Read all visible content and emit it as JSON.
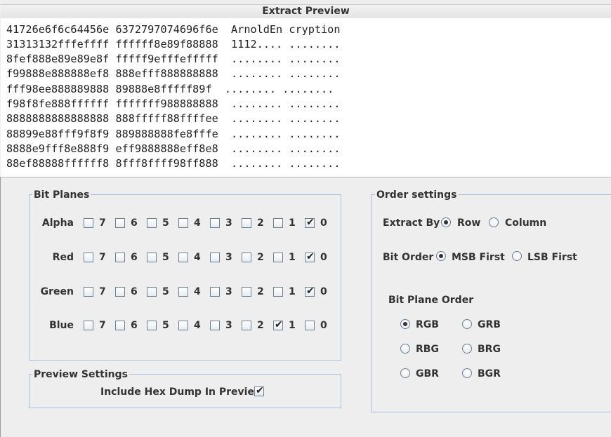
{
  "preview": {
    "title": "Extract Preview",
    "lines": [
      "41726e6f6c64456e 6372797074696f6e  ArnoldEn cryption",
      "31313132fffeffff ffffff8e89f88888  1112.... ........",
      "8fef888e89e89e8f fffff9efffefffff  ........ ........",
      "f99888e888888ef8 888efff888888888  ........ ........",
      "fff98ee888889888 89888e8fffff89f  ........ ........",
      "f98f8fe888ffffff fffffff988888888  ........ ........",
      "8888888888888888 888fffff88ffffee  ........ ........",
      "88899e88fff9f8f9 889888888fe8fffe  ........ ........",
      "8888e9fff8e888f9 eff9888888eff8e8  ........ ........",
      "88ef88888ffffff8 8fff8ffff98ff888  ........ ........"
    ]
  },
  "bit_planes": {
    "title": "Bit Planes",
    "bits": [
      "7",
      "6",
      "5",
      "4",
      "3",
      "2",
      "1",
      "0"
    ],
    "rows": [
      {
        "label": "Alpha",
        "checked": [
          false,
          false,
          false,
          false,
          false,
          false,
          false,
          true
        ]
      },
      {
        "label": "Red",
        "checked": [
          false,
          false,
          false,
          false,
          false,
          false,
          false,
          true
        ]
      },
      {
        "label": "Green",
        "checked": [
          false,
          false,
          false,
          false,
          false,
          false,
          false,
          true
        ]
      },
      {
        "label": "Blue",
        "checked": [
          false,
          false,
          false,
          false,
          false,
          false,
          true,
          false
        ]
      }
    ],
    "check_glyph": "✔"
  },
  "preview_settings": {
    "title": "Preview Settings",
    "hex_dump_label": "Include Hex Dump In Preview",
    "hex_dump_checked": true
  },
  "order_settings": {
    "title": "Order settings",
    "extract_by": {
      "label": "Extract By",
      "options": [
        "Row",
        "Column"
      ],
      "selected": "Row"
    },
    "bit_order": {
      "label": "Bit Order",
      "options": [
        "MSB First",
        "LSB First"
      ],
      "selected": "MSB First"
    },
    "bit_plane_order": {
      "label": "Bit Plane Order",
      "options": [
        "RGB",
        "GRB",
        "RBG",
        "BRG",
        "GBR",
        "BGR"
      ],
      "selected": "RGB"
    }
  }
}
